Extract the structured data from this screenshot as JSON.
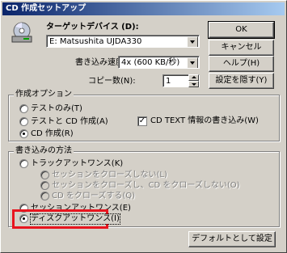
{
  "window": {
    "title": "CD 作成セットアップ"
  },
  "device": {
    "label": "ターゲットデバイス (D):",
    "value": "E: Matsushita UJDA330"
  },
  "speed": {
    "label": "書き込み速度(S):",
    "value": "4x (600 KB/秒)"
  },
  "copies": {
    "label": "コピー数(N):",
    "value": "1"
  },
  "buttons": {
    "ok": "OK",
    "cancel": "キャンセル",
    "help": "ヘルプ(H)",
    "hide_settings": "設定を隠す(Y)",
    "set_default": "デフォルトとして設定"
  },
  "create_options": {
    "title": "作成オプション",
    "test_only": "テストのみ(T)",
    "test_and_create": "テストと CD 作成(A)",
    "create_cd": "CD 作成(R)",
    "cd_text": "CD TEXT 情報の書き込み(W)",
    "selected": "create_cd",
    "cd_text_checked": true
  },
  "write_method": {
    "title": "書き込みの方法",
    "track_at_once": "トラックアットワンス(K)",
    "no_close_session": "セッションをクローズしない(L)",
    "close_session_no_cd": "セッションをクローズし、CD をクローズしない(O)",
    "close_cd": "CD をクローズする(Q)",
    "session_at_once": "セッションアットワンス(E)",
    "disc_at_once": "ディスクアットワンス(I)",
    "selected": "disc_at_once"
  }
}
